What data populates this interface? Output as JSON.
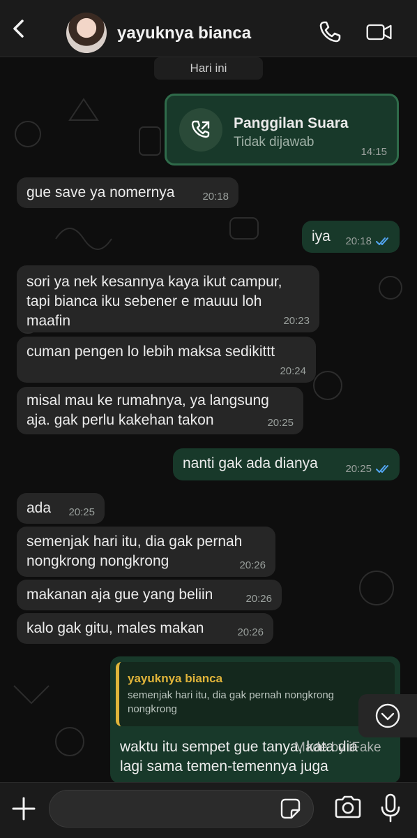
{
  "header": {
    "contact_name": "yayuknya bianca"
  },
  "chat": {
    "date_label": "Hari ini",
    "call": {
      "title": "Panggilan Suara",
      "subtitle": "Tidak dijawab",
      "time": "14:15"
    },
    "messages": [
      {
        "dir": "in",
        "text": "gue save ya nomernya",
        "time": "20:18"
      },
      {
        "dir": "out",
        "text": "iya",
        "time": "20:18"
      },
      {
        "dir": "in",
        "text": "sori ya nek kesannya kaya ikut campur,\ntapi bianca iku sebener e mauuu loh\nmaafin",
        "time": "20:23"
      },
      {
        "dir": "in",
        "text": "cuman pengen lo lebih maksa sedikittt",
        "time": "20:24"
      },
      {
        "dir": "in",
        "text": "misal mau ke rumahnya, ya langsung\naja. gak perlu kakehan takon",
        "time": "20:25"
      },
      {
        "dir": "out",
        "text": "nanti gak ada dianya",
        "time": "20:25"
      },
      {
        "dir": "in",
        "text": "ada",
        "time": "20:25"
      },
      {
        "dir": "in",
        "text": "semenjak hari itu, dia gak pernah\nnongkrong nongkrong",
        "time": "20:26"
      },
      {
        "dir": "in",
        "text": "makanan aja gue yang beliin",
        "time": "20:26"
      },
      {
        "dir": "in",
        "text": "kalo gak gitu, males makan",
        "time": "20:26"
      }
    ],
    "reply": {
      "quoted_name": "yayuknya bianca",
      "quoted_text": "semenjak hari itu, dia gak pernah nongkrong nongkrong",
      "text": "waktu itu sempet gue tanya, kata dia\nlagi sama temen-temennya juga"
    },
    "watermark": "Made by iFake"
  },
  "colors": {
    "incoming_bubble": "#262626",
    "outgoing_bubble": "#18392a",
    "quote_accent": "#e0b43a",
    "read_ticks": "#53a6f2"
  },
  "icons": {
    "back": "chevron-left",
    "voice_call": "phone",
    "video_call": "video-camera",
    "call_log": "outgoing-call",
    "scroll_down": "chevron-down-circle",
    "attach": "plus",
    "sticker": "sticker",
    "camera": "camera",
    "microphone": "microphone"
  }
}
